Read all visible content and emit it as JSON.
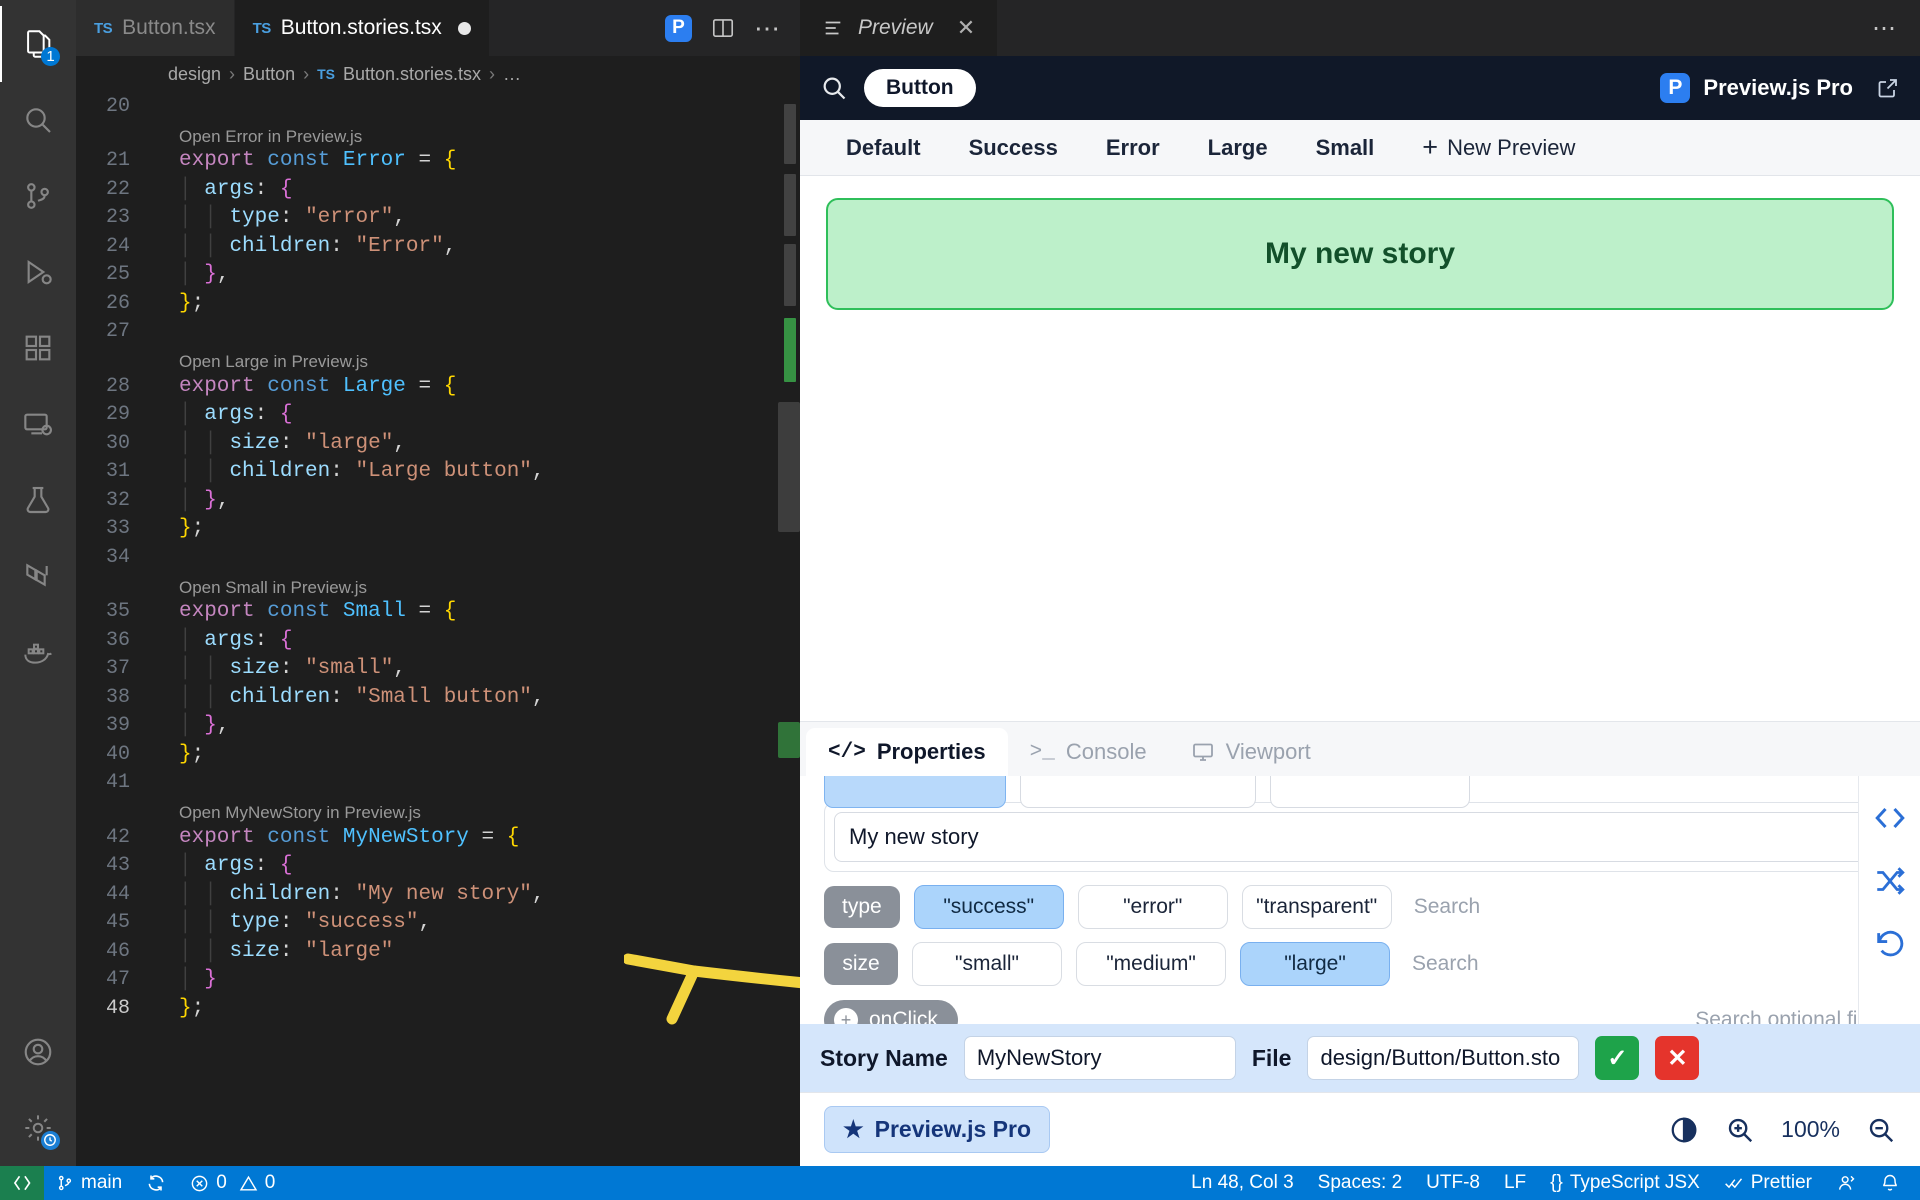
{
  "editor": {
    "tabs": [
      {
        "name": "Button.tsx",
        "badge": "TS",
        "active": false,
        "dirty": false
      },
      {
        "name": "Button.stories.tsx",
        "badge": "TS",
        "active": true,
        "dirty": true
      }
    ],
    "breadcrumb": {
      "part1": "design",
      "part2": "Button",
      "badge": "TS",
      "part3": "Button.stories.tsx",
      "part4": "…",
      "sep": "›"
    },
    "activity_badge": "1",
    "lines": [
      {
        "num": "20",
        "text": ""
      },
      {
        "lens": "Open Error in Preview.js"
      },
      {
        "num": "21",
        "text": "export const Error = {"
      },
      {
        "num": "22",
        "text": "  args: {"
      },
      {
        "num": "23",
        "text": "    type: \"error\","
      },
      {
        "num": "24",
        "text": "    children: \"Error\","
      },
      {
        "num": "25",
        "text": "  },"
      },
      {
        "num": "26",
        "text": "};"
      },
      {
        "num": "27",
        "text": ""
      },
      {
        "lens": "Open Large in Preview.js"
      },
      {
        "num": "28",
        "text": "export const Large = {"
      },
      {
        "num": "29",
        "text": "  args: {"
      },
      {
        "num": "30",
        "text": "    size: \"large\","
      },
      {
        "num": "31",
        "text": "    children: \"Large button\","
      },
      {
        "num": "32",
        "text": "  },"
      },
      {
        "num": "33",
        "text": "};"
      },
      {
        "num": "34",
        "text": ""
      },
      {
        "lens": "Open Small in Preview.js"
      },
      {
        "num": "35",
        "text": "export const Small = {"
      },
      {
        "num": "36",
        "text": "  args: {"
      },
      {
        "num": "37",
        "text": "    size: \"small\","
      },
      {
        "num": "38",
        "text": "    children: \"Small button\","
      },
      {
        "num": "39",
        "text": "  },"
      },
      {
        "num": "40",
        "text": "};"
      },
      {
        "num": "41",
        "text": ""
      },
      {
        "lens": "Open MyNewStory in Preview.js"
      },
      {
        "num": "42",
        "text": "export const MyNewStory = {",
        "modified": true
      },
      {
        "num": "43",
        "text": "  args: {",
        "modified": true
      },
      {
        "num": "44",
        "text": "    children: \"My new story\",",
        "modified": true
      },
      {
        "num": "45",
        "text": "    type: \"success\",",
        "modified": true
      },
      {
        "num": "46",
        "text": "    size: \"large\"",
        "modified": true
      },
      {
        "num": "47",
        "text": "  }",
        "modified": true
      },
      {
        "num": "48",
        "text": "};",
        "modified": true,
        "current": true
      }
    ]
  },
  "preview": {
    "titlebar": {
      "title": "Preview",
      "close": "✕",
      "more": "⋯"
    },
    "header": {
      "chip": "Button",
      "brand": "Preview.js Pro",
      "brand_logo": "P",
      "search_icon": "search-icon",
      "external_icon": "external-link-icon"
    },
    "tabs": [
      {
        "label": "Default",
        "active": false
      },
      {
        "label": "Success",
        "active": false
      },
      {
        "label": "Error",
        "active": false
      },
      {
        "label": "Large",
        "active": false
      },
      {
        "label": "Small",
        "active": false
      }
    ],
    "new_preview": {
      "plus": "+",
      "label": "New Preview"
    },
    "story_button": {
      "label": "My new story",
      "bg": "#bdf0ca",
      "border": "#2fbf5a",
      "text_color": "#12502a"
    },
    "dock_tabs": [
      {
        "label": "Properties",
        "icon": "</>",
        "active": true
      },
      {
        "label": "Console",
        "icon": ">_",
        "active": false
      },
      {
        "label": "Viewport",
        "icon": "monitor-icon",
        "active": false
      }
    ],
    "properties": {
      "children_value": "My new story",
      "rows": [
        {
          "key": "type",
          "options": [
            {
              "label": "\"success\"",
              "selected": true
            },
            {
              "label": "\"error\"",
              "selected": false
            },
            {
              "label": "\"transparent\"",
              "selected": false
            }
          ],
          "search_placeholder": "Search",
          "clear": "✕"
        },
        {
          "key": "size",
          "options": [
            {
              "label": "\"small\"",
              "selected": false
            },
            {
              "label": "\"medium\"",
              "selected": false
            },
            {
              "label": "\"large\"",
              "selected": true
            }
          ],
          "search_placeholder": "Search",
          "clear": "✕"
        }
      ],
      "add_field": {
        "plus": "+",
        "label": "onClick"
      },
      "optional_hint": "Search optional fields"
    },
    "story_bar": {
      "story_name_label": "Story Name",
      "story_name_value": "MyNewStory",
      "file_label": "File",
      "file_value": "design/Button/Button.sto",
      "confirm": "✓",
      "cancel": "✕"
    },
    "footer": {
      "pro_label": "Preview.js Pro",
      "star": "★",
      "contrast_icon": "contrast-icon",
      "zoom_in_icon": "zoom-in-icon",
      "zoom_level": "100%",
      "zoom_out_icon": "zoom-out-icon"
    },
    "right_rail": [
      {
        "icon": "code-icon",
        "name": "code-icon"
      },
      {
        "icon": "shuffle-icon",
        "name": "shuffle-icon"
      },
      {
        "icon": "reset-icon",
        "name": "reset-icon"
      }
    ]
  },
  "statusbar": {
    "remote_icon": "remote-indicator-icon",
    "branch": "main",
    "sync_icon": "sync-icon",
    "errors": "0",
    "warnings": "0",
    "position": "Ln 48, Col 3",
    "spaces": "Spaces: 2",
    "encoding": "UTF-8",
    "eol": "LF",
    "language": "TypeScript JSX",
    "language_icon": "{}",
    "formatter": "Prettier",
    "formatter_icon": "check-check-icon",
    "account_icon": "account-icon",
    "bell_icon": "bell-icon"
  },
  "annotation": {
    "type": "arrow",
    "color": "#f5d442",
    "direction": "left"
  },
  "colors": {
    "accent": "#0078d4",
    "success": "#2fbf5a",
    "editor_bg": "#1e1e1e",
    "panel_bg": "#252526",
    "preview_header": "#101828",
    "selected_option": "#abd4fb"
  }
}
